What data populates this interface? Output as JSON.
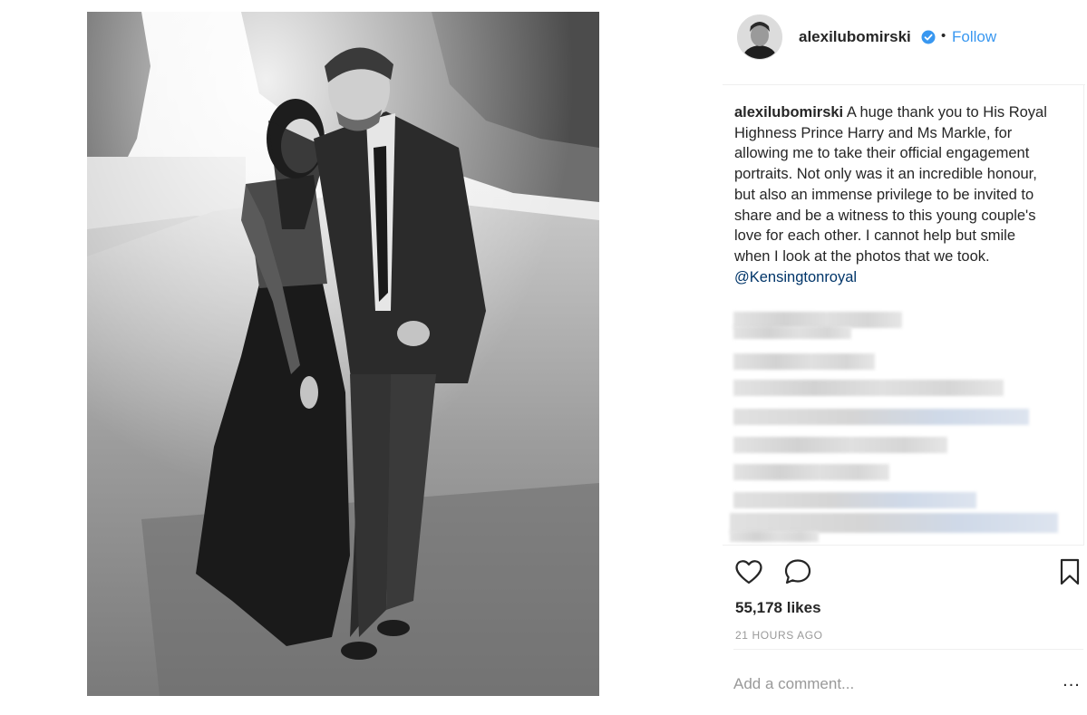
{
  "post": {
    "username": "alexilubomirski",
    "separator": "•",
    "follow_label": "Follow",
    "caption_user": "alexilubomirski",
    "caption_text": "A huge thank you to His Royal Highness Prince Harry and Ms Markle, for allowing me to take their official engagement portraits. Not only was it an incredible honour, but also an immense privilege to be invited to share and be a witness to this young couple's love for each other.  I cannot help but smile when I look at the photos that we took. ",
    "caption_mention": "@Kensingtonroyal",
    "likes": "55,178 likes",
    "timestamp": "21 HOURS AGO",
    "comment_placeholder": "Add a comment...",
    "more_label": "...",
    "verified_color": "#3897f0",
    "follow_color": "#3897f0"
  },
  "icons": {
    "like": "heart-icon",
    "comment": "speech-bubble-icon",
    "save": "bookmark-icon",
    "verified": "verified-badge-icon",
    "more": "ellipsis-icon"
  }
}
